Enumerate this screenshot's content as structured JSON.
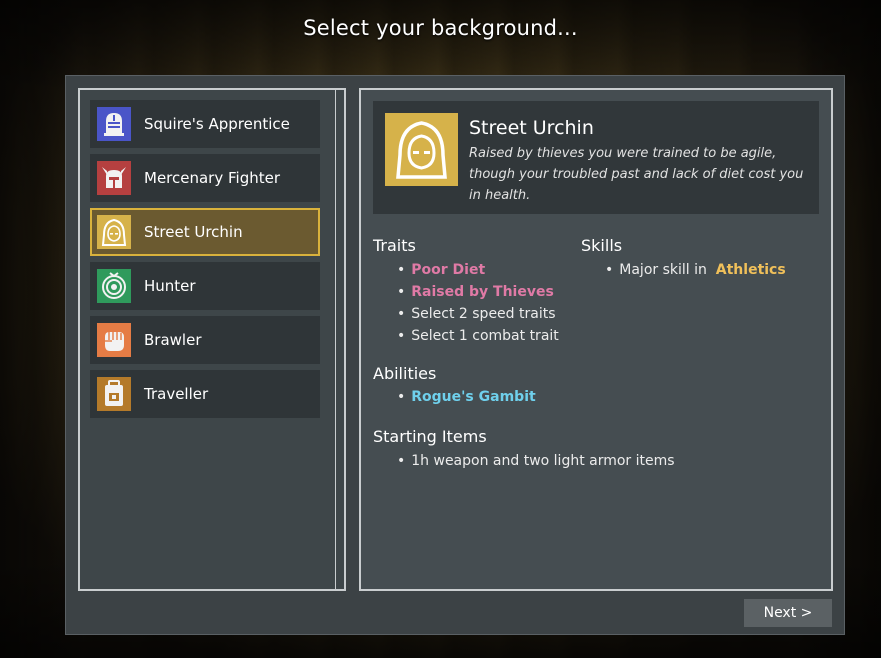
{
  "title": "Select your background...",
  "backgrounds": [
    {
      "label": "Squire's Apprentice",
      "icon": "knight-helmet-icon",
      "color": "#4a55c8"
    },
    {
      "label": "Mercenary Fighter",
      "icon": "horned-helmet-icon",
      "color": "#b54040"
    },
    {
      "label": "Street Urchin",
      "icon": "hooded-figure-icon",
      "color": "#d6b24a"
    },
    {
      "label": "Hunter",
      "icon": "target-icon",
      "color": "#2f9a5c"
    },
    {
      "label": "Brawler",
      "icon": "fist-icon",
      "color": "#e57c45"
    },
    {
      "label": "Traveller",
      "icon": "backpack-icon",
      "color": "#b47a2a"
    }
  ],
  "selected_index": 2,
  "detail": {
    "name": "Street Urchin",
    "description": "Raised by thieves you were trained to be agile, though your troubled past and lack of diet cost you in health.",
    "traits_heading": "Traits",
    "traits": [
      {
        "text": "Poor Diet",
        "style": "pink"
      },
      {
        "text": "Raised by Thieves",
        "style": "pink"
      },
      {
        "text": "Select 2 speed traits",
        "style": "plain"
      },
      {
        "text": "Select 1 combat trait",
        "style": "plain"
      }
    ],
    "skills_heading": "Skills",
    "skill_prefix": "Major skill in",
    "skill_name": "Athletics",
    "abilities_heading": "Abilities",
    "abilities": [
      "Rogue's Gambit"
    ],
    "starting_items_heading": "Starting Items",
    "starting_items": [
      "1h weapon and two light armor items"
    ]
  },
  "next_label": "Next >",
  "colors": {
    "selected_border": "#d9b23c",
    "trait_highlight": "#e07aa6",
    "ability_highlight": "#6fd0ec",
    "skill_highlight": "#f0c05a"
  }
}
